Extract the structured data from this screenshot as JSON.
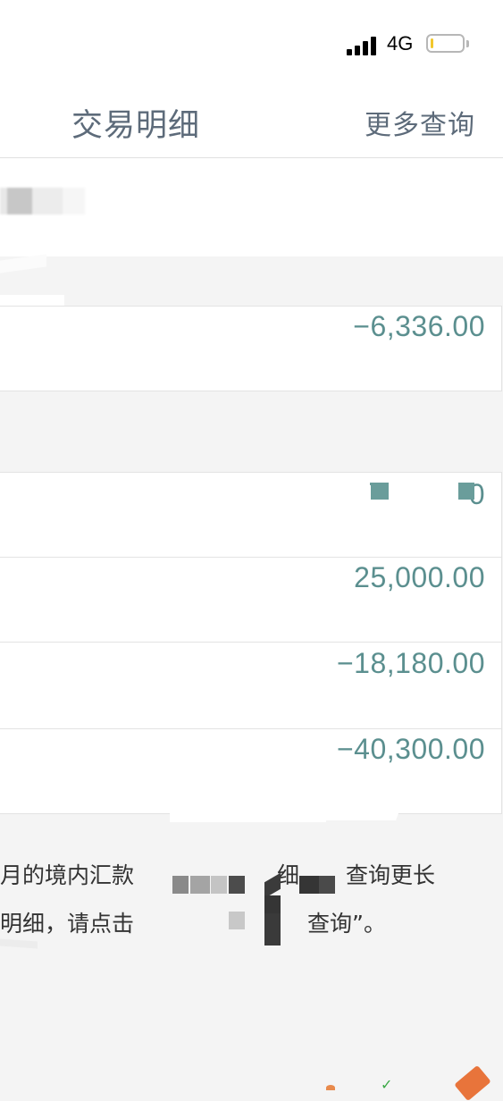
{
  "status_bar": {
    "network": "4G",
    "battery_level": 0.08,
    "battery_color": "#f2c72c"
  },
  "nav": {
    "title": "交易明细",
    "more_query": "更多查询"
  },
  "transactions": [
    {
      "amount": "−6,336.00"
    },
    {
      "amount": "0"
    },
    {
      "amount": "25,000.00"
    },
    {
      "amount": "−18,180.00"
    },
    {
      "amount": "−40,300.00"
    }
  ],
  "notice": {
    "line1_start": "月的境内汇款",
    "line1_mid": "细，",
    "line1_end": "查询更长",
    "line2_start": "明细，请点击",
    "line2_end": "查询”。"
  },
  "colors": {
    "amount": "#5b8f8f",
    "nav_text": "#5d6b7a",
    "background": "#f4f4f4"
  }
}
